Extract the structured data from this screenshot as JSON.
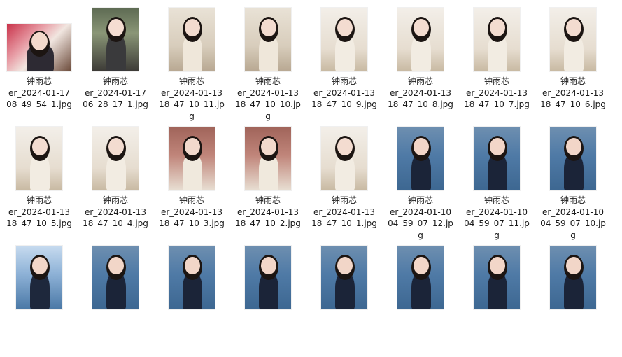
{
  "files": [
    {
      "name_lines": [
        "钟雨芯",
        "er_2024-01-17",
        "08_49_54_1.jpg"
      ],
      "shape": "landscape",
      "theme": "red-room"
    },
    {
      "name_lines": [
        "钟雨芯",
        "er_2024-01-17",
        "06_28_17_1.jpg"
      ],
      "shape": "portrait",
      "theme": "selfie"
    },
    {
      "name_lines": [
        "钟雨芯",
        "er_2024-01-13",
        "18_47_10_11.jp",
        "g"
      ],
      "shape": "portrait",
      "theme": "cafe"
    },
    {
      "name_lines": [
        "钟雨芯",
        "er_2024-01-13",
        "18_47_10_10.jp",
        "g"
      ],
      "shape": "portrait",
      "theme": "cafe"
    },
    {
      "name_lines": [
        "钟雨芯",
        "er_2024-01-13",
        "18_47_10_9.jpg"
      ],
      "shape": "portrait",
      "theme": "cafe-light"
    },
    {
      "name_lines": [
        "钟雨芯",
        "er_2024-01-13",
        "18_47_10_8.jpg"
      ],
      "shape": "portrait",
      "theme": "cafe-light"
    },
    {
      "name_lines": [
        "钟雨芯",
        "er_2024-01-13",
        "18_47_10_7.jpg"
      ],
      "shape": "portrait",
      "theme": "cafe-light"
    },
    {
      "name_lines": [
        "钟雨芯",
        "er_2024-01-13",
        "18_47_10_6.jpg"
      ],
      "shape": "portrait",
      "theme": "cafe-light"
    },
    {
      "name_lines": [
        "钟雨芯",
        "er_2024-01-13",
        "18_47_10_5.jpg"
      ],
      "shape": "portrait",
      "theme": "cafe-light"
    },
    {
      "name_lines": [
        "钟雨芯",
        "er_2024-01-13",
        "18_47_10_4.jpg"
      ],
      "shape": "portrait",
      "theme": "cafe-light"
    },
    {
      "name_lines": [
        "钟雨芯",
        "er_2024-01-13",
        "18_47_10_3.jpg"
      ],
      "shape": "portrait",
      "theme": "brick"
    },
    {
      "name_lines": [
        "钟雨芯",
        "er_2024-01-13",
        "18_47_10_2.jpg"
      ],
      "shape": "portrait",
      "theme": "brick"
    },
    {
      "name_lines": [
        "钟雨芯",
        "er_2024-01-13",
        "18_47_10_1.jpg"
      ],
      "shape": "portrait",
      "theme": "cafe-light"
    },
    {
      "name_lines": [
        "钟雨芯",
        "er_2024-01-10",
        "04_59_07_12.jp",
        "g"
      ],
      "shape": "portrait",
      "theme": "lake"
    },
    {
      "name_lines": [
        "钟雨芯",
        "er_2024-01-10",
        "04_59_07_11.jp",
        "g"
      ],
      "shape": "portrait",
      "theme": "lake"
    },
    {
      "name_lines": [
        "钟雨芯",
        "er_2024-01-10",
        "04_59_07_10.jp",
        "g"
      ],
      "shape": "portrait",
      "theme": "lake"
    },
    {
      "name_lines": [],
      "shape": "portrait",
      "theme": "lake-sky"
    },
    {
      "name_lines": [],
      "shape": "portrait",
      "theme": "lake"
    },
    {
      "name_lines": [],
      "shape": "portrait",
      "theme": "lake"
    },
    {
      "name_lines": [],
      "shape": "portrait",
      "theme": "lake"
    },
    {
      "name_lines": [],
      "shape": "portrait",
      "theme": "lake"
    },
    {
      "name_lines": [],
      "shape": "portrait",
      "theme": "lake"
    },
    {
      "name_lines": [],
      "shape": "portrait",
      "theme": "lake"
    },
    {
      "name_lines": [],
      "shape": "portrait",
      "theme": "lake"
    }
  ],
  "themes": {
    "red-room": {
      "bg": "linear-gradient(135deg,#c9324a 0%,#e8a0a8 35%,#f1e6e0 55%,#6b4a3a 100%)",
      "body": "#2d2a33",
      "skin": "#f3d9cc"
    },
    "selfie": {
      "bg": "linear-gradient(180deg,#5d6a52 0%,#8a9677 40%,#3c3a36 100%)",
      "body": "#3a3a3c",
      "skin": "#f5ddd2"
    },
    "cafe": {
      "bg": "linear-gradient(180deg,#e9e2d6 0%,#d8cdbc 60%,#b8a892 100%)",
      "body": "#efe7da",
      "skin": "#f2dbcf"
    },
    "cafe-light": {
      "bg": "linear-gradient(180deg,#f3efe9 0%,#e6ddd0 65%,#c8b9a2 100%)",
      "body": "#f2ece2",
      "skin": "#f3dcd0"
    },
    "brick": {
      "bg": "linear-gradient(180deg,#a0645a 0%,#c0857a 45%,#e8dfd3 100%)",
      "body": "#f0e9dd",
      "skin": "#f2d9cc"
    },
    "lake": {
      "bg": "linear-gradient(180deg,#6e8fb0 0%,#4f7aa6 45%,#3d6791 100%)",
      "body": "#1b2438",
      "skin": "#f2d6c8"
    },
    "lake-sky": {
      "bg": "linear-gradient(180deg,#c7dbef 0%,#8db1d6 45%,#4a78a6 100%)",
      "body": "#1e283c",
      "skin": "#f2d6c8"
    }
  }
}
